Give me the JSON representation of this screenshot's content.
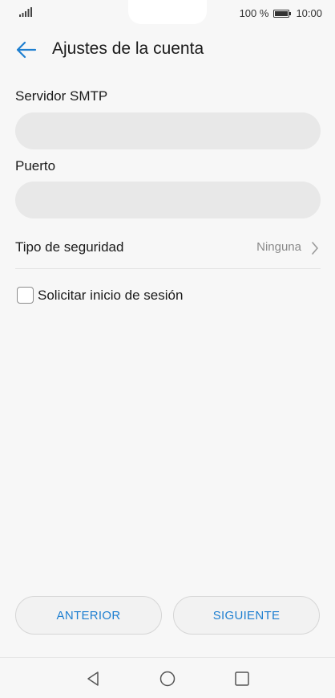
{
  "status_bar": {
    "battery_percent": "100 %",
    "time": "10:00",
    "icons": [
      "signal-icon",
      "battery-icon"
    ]
  },
  "header": {
    "title": "Ajustes de la cuenta",
    "back_icon": "back-arrow-icon"
  },
  "form": {
    "smtp_server": {
      "label": "Servidor SMTP",
      "value": "",
      "placeholder": ""
    },
    "port": {
      "label": "Puerto",
      "value": "",
      "placeholder": ""
    },
    "security": {
      "label": "Tipo de seguridad",
      "value": "Ninguna"
    },
    "require_signin": {
      "label": "Solicitar inicio de sesión",
      "checked": false
    }
  },
  "buttons": {
    "previous": "ANTERIOR",
    "next": "SIGUIENTE"
  },
  "nav_bar": {
    "icons": [
      "nav-back-icon",
      "nav-home-icon",
      "nav-recents-icon"
    ]
  },
  "colors": {
    "accent": "#1e7fd0",
    "background": "#f7f7f7",
    "input_fill": "#e8e8e8"
  }
}
